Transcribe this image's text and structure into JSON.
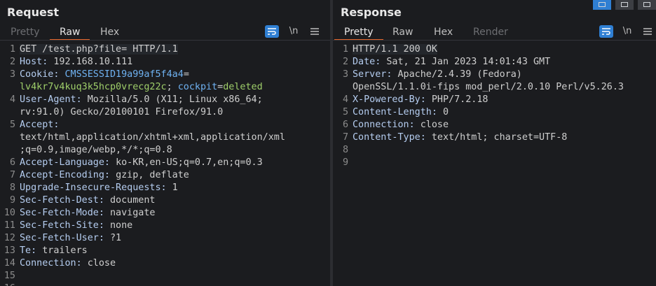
{
  "request": {
    "title": "Request",
    "tabs": [
      {
        "label": "Pretty",
        "state": "dim"
      },
      {
        "label": "Raw",
        "state": "active"
      },
      {
        "label": "Hex",
        "state": "normal"
      }
    ],
    "tools": {
      "wrap_icon": "word-wrap-icon",
      "newline_label": "\\n",
      "menu_icon": "hamburger-menu-icon"
    },
    "lines": [
      {
        "n": "1",
        "parts": [
          {
            "t": "GET /test.php?file= HTTP/1.1",
            "c": "v"
          }
        ],
        "highlight": true
      },
      {
        "n": "2",
        "parts": [
          {
            "t": "Host: ",
            "c": "k"
          },
          {
            "t": "192.168.10.111",
            "c": "v"
          }
        ]
      },
      {
        "n": "3",
        "parts": [
          {
            "t": "Cookie: ",
            "c": "k"
          },
          {
            "t": "CMSSESSID19a99af5f4a4",
            "c": "link"
          },
          {
            "t": "=",
            "c": "v"
          }
        ]
      },
      {
        "n": "",
        "parts": [
          {
            "t": "lv4kr7v4kuq3k5hcp0vrecg22c",
            "c": "green"
          },
          {
            "t": "; ",
            "c": "v"
          },
          {
            "t": "cockpit",
            "c": "link"
          },
          {
            "t": "=",
            "c": "v"
          },
          {
            "t": "deleted",
            "c": "green"
          }
        ]
      },
      {
        "n": "4",
        "parts": [
          {
            "t": "User-Agent: ",
            "c": "k"
          },
          {
            "t": "Mozilla/5.0 (X11; Linux x86_64;",
            "c": "v"
          }
        ]
      },
      {
        "n": "",
        "parts": [
          {
            "t": "rv:91.0) Gecko/20100101 Firefox/91.0",
            "c": "v"
          }
        ]
      },
      {
        "n": "5",
        "parts": [
          {
            "t": "Accept: ",
            "c": "k"
          }
        ]
      },
      {
        "n": "",
        "parts": [
          {
            "t": "text/html,application/xhtml+xml,application/xml",
            "c": "v"
          }
        ]
      },
      {
        "n": "",
        "parts": [
          {
            "t": ";q=0.9,image/webp,*/*;q=0.8",
            "c": "v"
          }
        ]
      },
      {
        "n": "6",
        "parts": [
          {
            "t": "Accept-Language: ",
            "c": "k"
          },
          {
            "t": "ko-KR,en-US;q=0.7,en;q=0.3",
            "c": "v"
          }
        ]
      },
      {
        "n": "7",
        "parts": [
          {
            "t": "Accept-Encoding: ",
            "c": "k"
          },
          {
            "t": "gzip, deflate",
            "c": "v"
          }
        ]
      },
      {
        "n": "8",
        "parts": [
          {
            "t": "Upgrade-Insecure-Requests: ",
            "c": "k"
          },
          {
            "t": "1",
            "c": "v"
          }
        ]
      },
      {
        "n": "9",
        "parts": [
          {
            "t": "Sec-Fetch-Dest: ",
            "c": "k"
          },
          {
            "t": "document",
            "c": "v"
          }
        ]
      },
      {
        "n": "10",
        "parts": [
          {
            "t": "Sec-Fetch-Mode: ",
            "c": "k"
          },
          {
            "t": "navigate",
            "c": "v"
          }
        ]
      },
      {
        "n": "11",
        "parts": [
          {
            "t": "Sec-Fetch-Site: ",
            "c": "k"
          },
          {
            "t": "none",
            "c": "v"
          }
        ]
      },
      {
        "n": "12",
        "parts": [
          {
            "t": "Sec-Fetch-User: ",
            "c": "k"
          },
          {
            "t": "?1",
            "c": "v"
          }
        ]
      },
      {
        "n": "13",
        "parts": [
          {
            "t": "Te: ",
            "c": "k"
          },
          {
            "t": "trailers",
            "c": "v"
          }
        ]
      },
      {
        "n": "14",
        "parts": [
          {
            "t": "Connection: ",
            "c": "k"
          },
          {
            "t": "close",
            "c": "v"
          }
        ]
      },
      {
        "n": "15",
        "parts": []
      },
      {
        "n": "16",
        "parts": []
      }
    ]
  },
  "response": {
    "title": "Response",
    "tabs": [
      {
        "label": "Pretty",
        "state": "active"
      },
      {
        "label": "Raw",
        "state": "normal"
      },
      {
        "label": "Hex",
        "state": "normal"
      },
      {
        "label": "Render",
        "state": "dim"
      }
    ],
    "tools": {
      "wrap_icon": "word-wrap-icon",
      "newline_label": "\\n",
      "menu_icon": "hamburger-menu-icon"
    },
    "lines": [
      {
        "n": "1",
        "parts": [
          {
            "t": "HTTP/1.1 200 OK",
            "c": "v"
          }
        ],
        "highlight": true
      },
      {
        "n": "2",
        "parts": [
          {
            "t": "Date: ",
            "c": "k"
          },
          {
            "t": "Sat, 21 Jan 2023 14:01:43 GMT",
            "c": "v"
          }
        ]
      },
      {
        "n": "3",
        "parts": [
          {
            "t": "Server: ",
            "c": "k"
          },
          {
            "t": "Apache/2.4.39 (Fedora)",
            "c": "v"
          }
        ]
      },
      {
        "n": "",
        "parts": [
          {
            "t": "OpenSSL/1.1.0i-fips mod_perl/2.0.10 Perl/v5.26.3",
            "c": "v"
          }
        ]
      },
      {
        "n": "4",
        "parts": [
          {
            "t": "X-Powered-By: ",
            "c": "k"
          },
          {
            "t": "PHP/7.2.18",
            "c": "v"
          }
        ]
      },
      {
        "n": "5",
        "parts": [
          {
            "t": "Content-Length: ",
            "c": "k"
          },
          {
            "t": "0",
            "c": "v"
          }
        ]
      },
      {
        "n": "6",
        "parts": [
          {
            "t": "Connection: ",
            "c": "k"
          },
          {
            "t": "close",
            "c": "v"
          }
        ]
      },
      {
        "n": "7",
        "parts": [
          {
            "t": "Content-Type: ",
            "c": "k"
          },
          {
            "t": "text/html; charset=UTF-8",
            "c": "v"
          }
        ]
      },
      {
        "n": "8",
        "parts": []
      },
      {
        "n": "9",
        "parts": []
      }
    ]
  },
  "layout_buttons": [
    {
      "icon": "split-horizontal-icon",
      "active": true
    },
    {
      "icon": "split-vertical-icon",
      "active": false
    },
    {
      "icon": "single-pane-icon",
      "active": false
    }
  ],
  "colors": {
    "accent": "#e8672c",
    "button_blue": "#2f7fd3",
    "header_key": "#b5cdf0",
    "cookie_name": "#6fb2f2",
    "cookie_value": "#9fcf6a"
  }
}
